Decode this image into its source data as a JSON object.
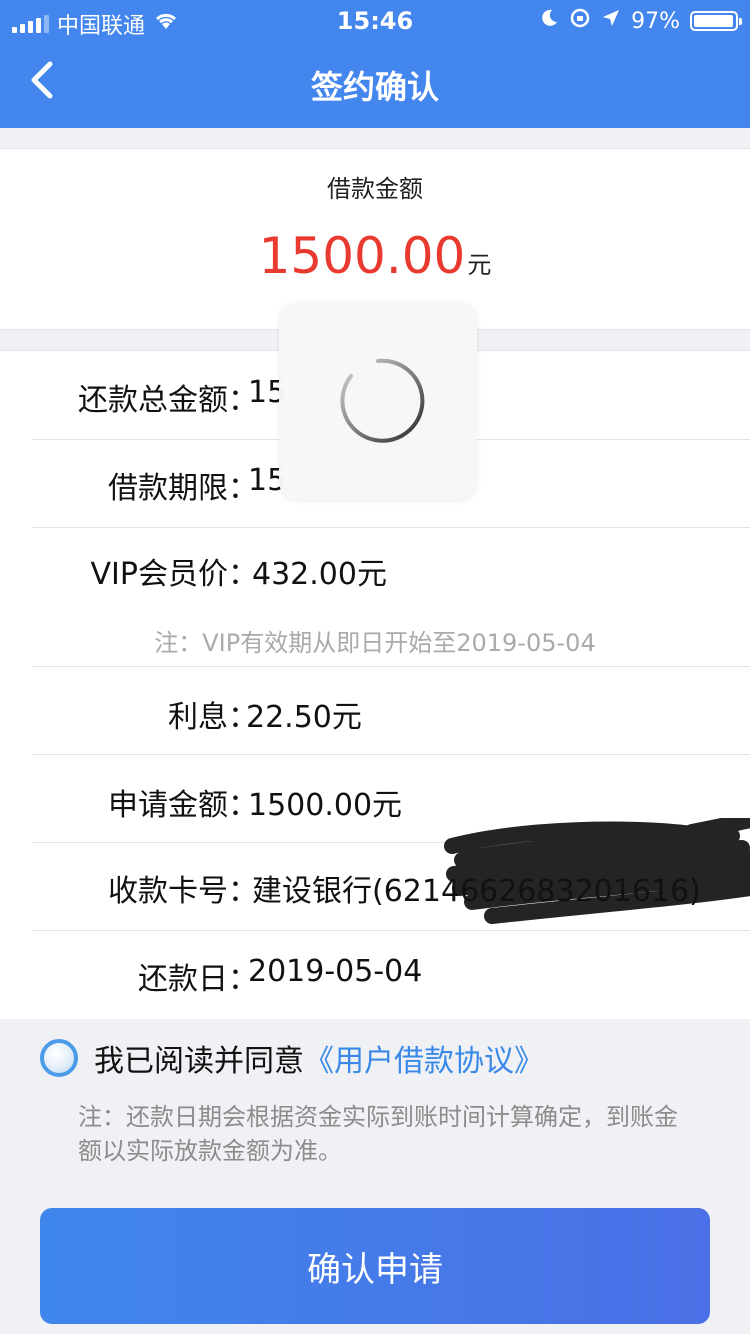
{
  "status_bar": {
    "carrier": "中国联通",
    "time": "15:46",
    "battery": "97%",
    "battery_level": 0.97
  },
  "nav": {
    "title": "签约确认",
    "back_icon": "chevron-left-icon"
  },
  "amount": {
    "label": "借款金额",
    "value": "1500.00",
    "unit": "元"
  },
  "details": {
    "rows": [
      {
        "label": "还款总金额：",
        "value": "15"
      },
      {
        "label": "借款期限：",
        "value": "15"
      },
      {
        "label": "VIP会员价：",
        "value": "432.00元"
      },
      {
        "label": "利息：",
        "value": "22.50元"
      },
      {
        "label": "申请金额：",
        "value": "1500.00元"
      },
      {
        "label": "收款卡号：",
        "value": "建设银行(6214662683201616)"
      },
      {
        "label": "还款日：",
        "value": "2019-05-04"
      }
    ],
    "vip_note": "注：VIP有效期从即日开始至2019-05-04"
  },
  "agreement": {
    "text": "我已阅读并同意",
    "link": "《用户借款协议》",
    "note": "注：还款日期会根据资金实际到账时间计算确定，到账金额以实际放款金额为准。"
  },
  "confirm_button": "确认申请",
  "colors": {
    "primary": "#4386ee",
    "amount_red": "#e83a2f",
    "link_blue": "#3a89e8"
  }
}
